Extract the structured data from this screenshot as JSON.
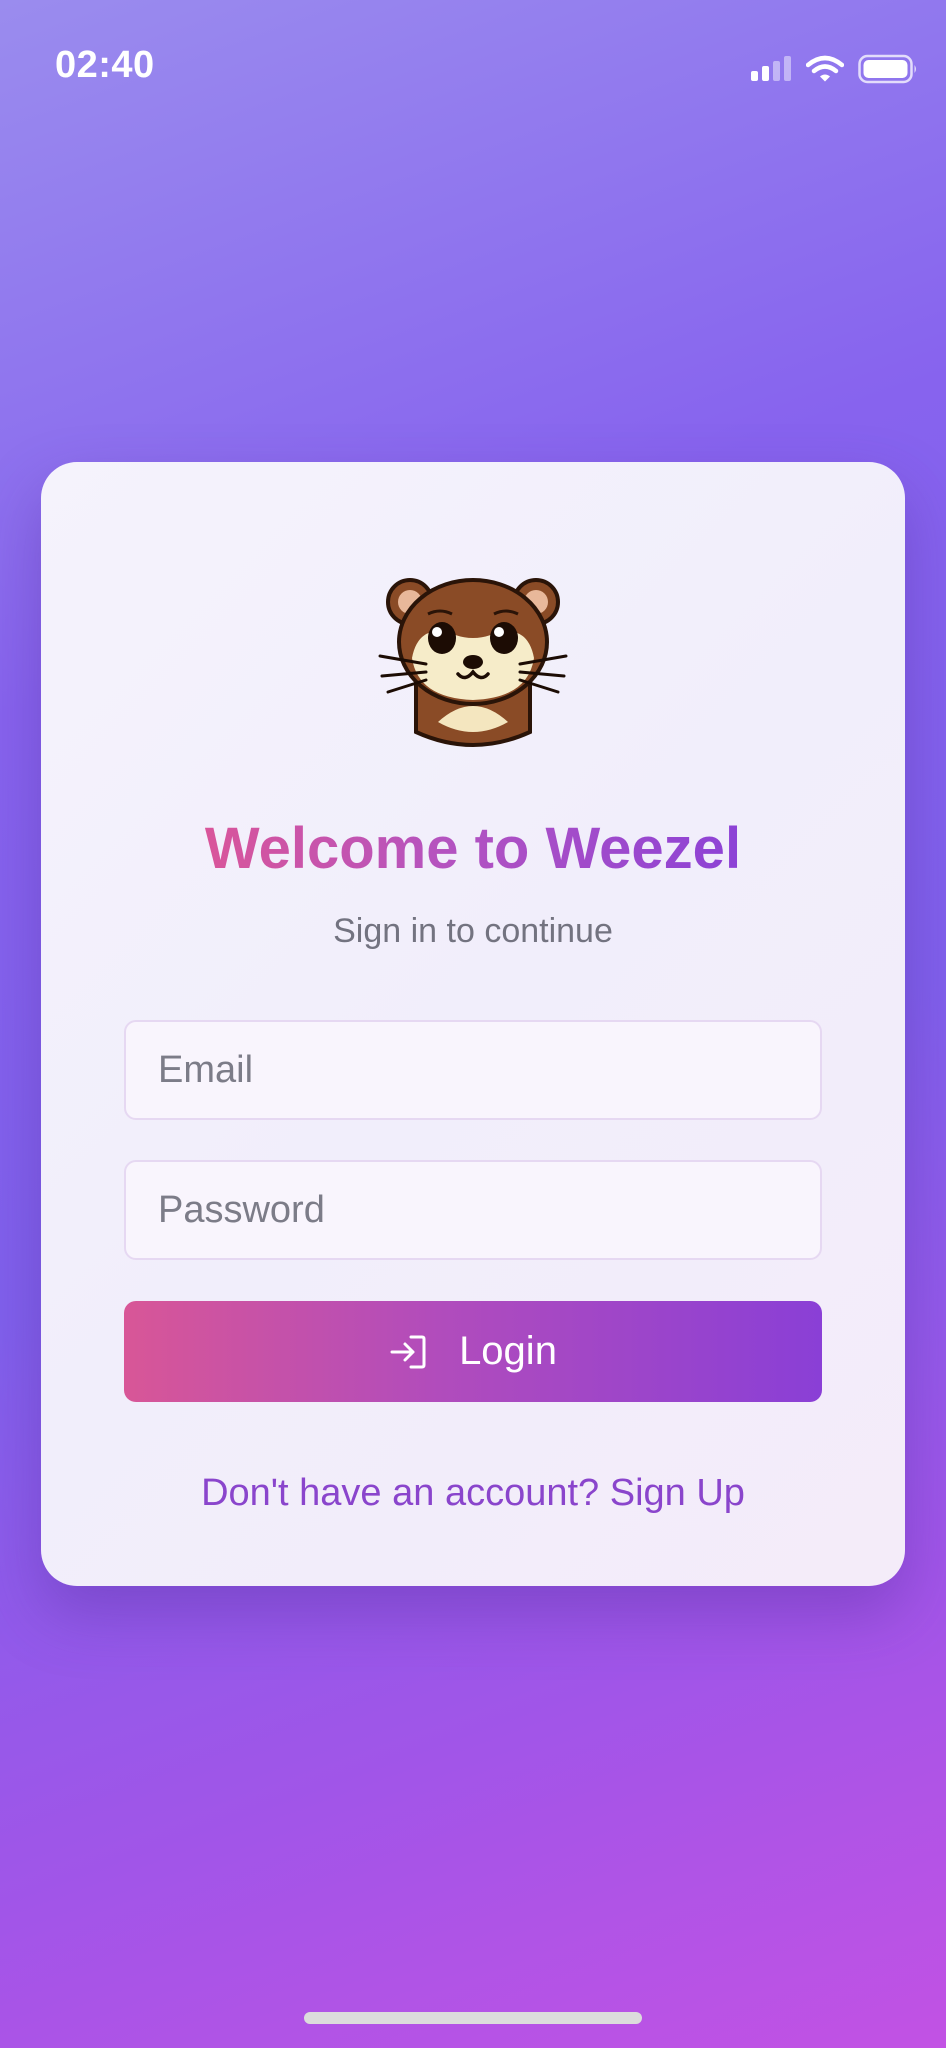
{
  "status_bar": {
    "time": "02:40",
    "icons": [
      "cellular-signal-icon",
      "wifi-icon",
      "battery-icon"
    ]
  },
  "login": {
    "title": "Welcome to Weezel",
    "subtitle": "Sign in to continue",
    "email_placeholder": "Email",
    "email_value": "",
    "password_placeholder": "Password",
    "password_value": "",
    "login_label": "Login",
    "login_icon": "login-arrow-icon",
    "signup_text": "Don't have an account? Sign Up",
    "mascot_icon": "weasel-mascot-icon"
  },
  "colors": {
    "accent_start": "#d85697",
    "accent_end": "#8a3fd6",
    "link": "#8a45cc",
    "subtitle": "#737380"
  }
}
